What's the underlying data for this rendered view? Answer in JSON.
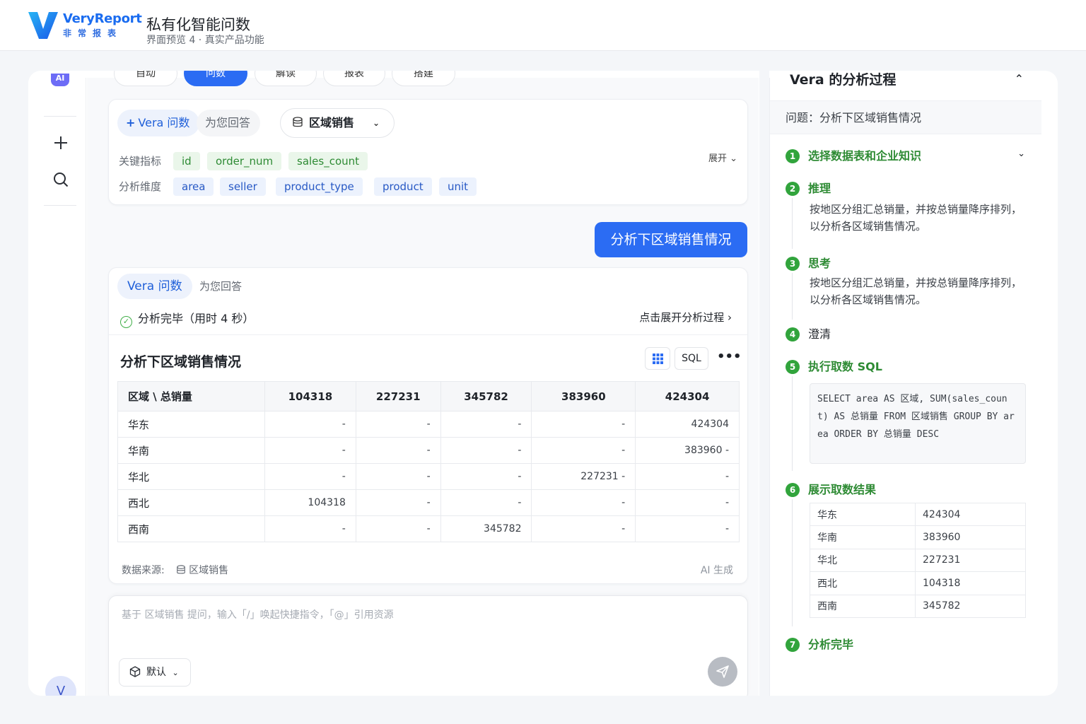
{
  "brand": {
    "name": "VeryReport",
    "sub": "非常报表"
  },
  "header": {
    "title": "私有化智能问数",
    "subtitle": "界面预览 4 · 真实产品功能"
  },
  "rail": {
    "badge": "AI",
    "avatar": "V"
  },
  "tabs": [
    "自动",
    "问数",
    "解读",
    "报表",
    "搭建"
  ],
  "context": {
    "vera_label": "Vera 问数",
    "answer_label": "为您回答",
    "datasource": "区域销售",
    "metrics_label": "关键指标",
    "metrics": [
      "id",
      "order_num",
      "sales_count"
    ],
    "dims_label": "分析维度",
    "dims": [
      "area",
      "seller",
      "product_type",
      "product",
      "unit"
    ],
    "expand": "展开"
  },
  "question": "分析下区域销售情况",
  "answer": {
    "vera_label": "Vera 问数",
    "answer_label": "为您回答",
    "status": "分析完毕（用时 4 秒）",
    "expand_process": "点击展开分析过程",
    "result_title": "分析下区域销售情况",
    "sql_button": "SQL",
    "more": "•••",
    "table": {
      "corner": "区域 \\ 总销量",
      "columns": [
        "104318",
        "227231",
        "345782",
        "383960",
        "424304"
      ],
      "rows": [
        {
          "name": "华东",
          "cells": [
            "-",
            "-",
            "-",
            "-",
            "424304"
          ]
        },
        {
          "name": "华南",
          "cells": [
            "-",
            "-",
            "-",
            "-",
            "383960  -"
          ]
        },
        {
          "name": "华北",
          "cells": [
            "-",
            "-",
            "-",
            "227231  -",
            "-"
          ]
        },
        {
          "name": "西北",
          "cells": [
            "104318",
            "-",
            "-",
            "-",
            "-"
          ]
        },
        {
          "name": "西南",
          "cells": [
            "-",
            "-",
            "345782",
            "-",
            "-"
          ]
        }
      ]
    },
    "source_label": "数据来源:",
    "source_name": "区域销售",
    "ai_label": "AI 生成"
  },
  "input": {
    "placeholder": "基于 区域销售 提问，输入「/」唤起快捷指令，「@」引用资源",
    "mode": "默认"
  },
  "panel": {
    "title": "Vera 的分析过程",
    "question": "问题：分析下区域销售情况",
    "steps": [
      {
        "n": "1",
        "label": "选择数据表和企业知识"
      },
      {
        "n": "2",
        "label": "推理",
        "desc": "按地区分组汇总销量，并按总销量降序排列，以分析各区域销售情况。"
      },
      {
        "n": "3",
        "label": "思考",
        "desc": "按地区分组汇总销量，并按总销量降序排列，以分析各区域销售情况。"
      },
      {
        "n": "4",
        "label": "澄清"
      },
      {
        "n": "5",
        "label": "执行取数 SQL"
      },
      {
        "n": "6",
        "label": "展示取数结果"
      },
      {
        "n": "7",
        "label": "分析完毕"
      }
    ],
    "sql": "SELECT area AS 区域, SUM(sales_count) AS 总销量 FROM 区域销售 GROUP BY area ORDER BY 总销量 DESC",
    "result": [
      [
        "华东",
        "424304"
      ],
      [
        "华南",
        "383960"
      ],
      [
        "华北",
        "227231"
      ],
      [
        "西北",
        "104318"
      ],
      [
        "西南",
        "345782"
      ]
    ]
  },
  "colors": {
    "accent": "#2b6cf3",
    "success": "#31a43c",
    "tag_green": "#2e8b34",
    "tag_blue": "#2859c5"
  }
}
